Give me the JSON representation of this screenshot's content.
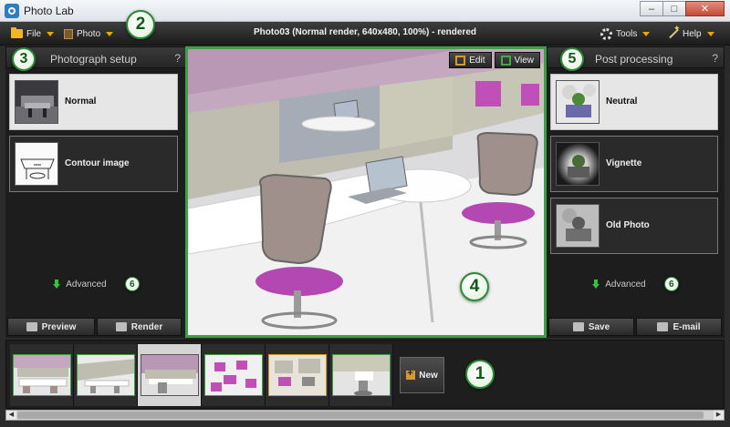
{
  "window": {
    "title": "Photo Lab",
    "min_glyph": "–",
    "max_glyph": "□",
    "close_glyph": "✕"
  },
  "menubar": {
    "file_label": "File",
    "photo_label": "Photo",
    "status": "Photo03 (Normal render, 640x480, 100%) - rendered",
    "tools_label": "Tools",
    "help_label": "Help"
  },
  "callouts": {
    "c1": "1",
    "c2": "2",
    "c3": "3",
    "c4": "4",
    "c5": "5",
    "c6": "6"
  },
  "setup_panel": {
    "title": "Photograph setup",
    "help": "?",
    "items": [
      {
        "label": "Normal",
        "selected": true
      },
      {
        "label": "Contour image",
        "selected": false
      }
    ],
    "advanced_label": "Advanced",
    "preview_label": "Preview",
    "render_label": "Render"
  },
  "viewport": {
    "edit_label": "Edit",
    "view_label": "View"
  },
  "post_panel": {
    "title": "Post processing",
    "help": "?",
    "items": [
      {
        "label": "Neutral",
        "selected": true
      },
      {
        "label": "Vignette",
        "selected": false
      },
      {
        "label": "Old Photo",
        "selected": false
      }
    ],
    "advanced_label": "Advanced",
    "save_label": "Save",
    "email_label": "E-mail"
  },
  "filmstrip": {
    "count": 6,
    "selected_index": 2,
    "new_label": "New"
  },
  "scroll": {
    "left": "◀",
    "right": "▶"
  },
  "colors": {
    "accent_green": "#3da047",
    "accent_orange": "#f0a400",
    "dark_bg": "#1d1d1d"
  }
}
